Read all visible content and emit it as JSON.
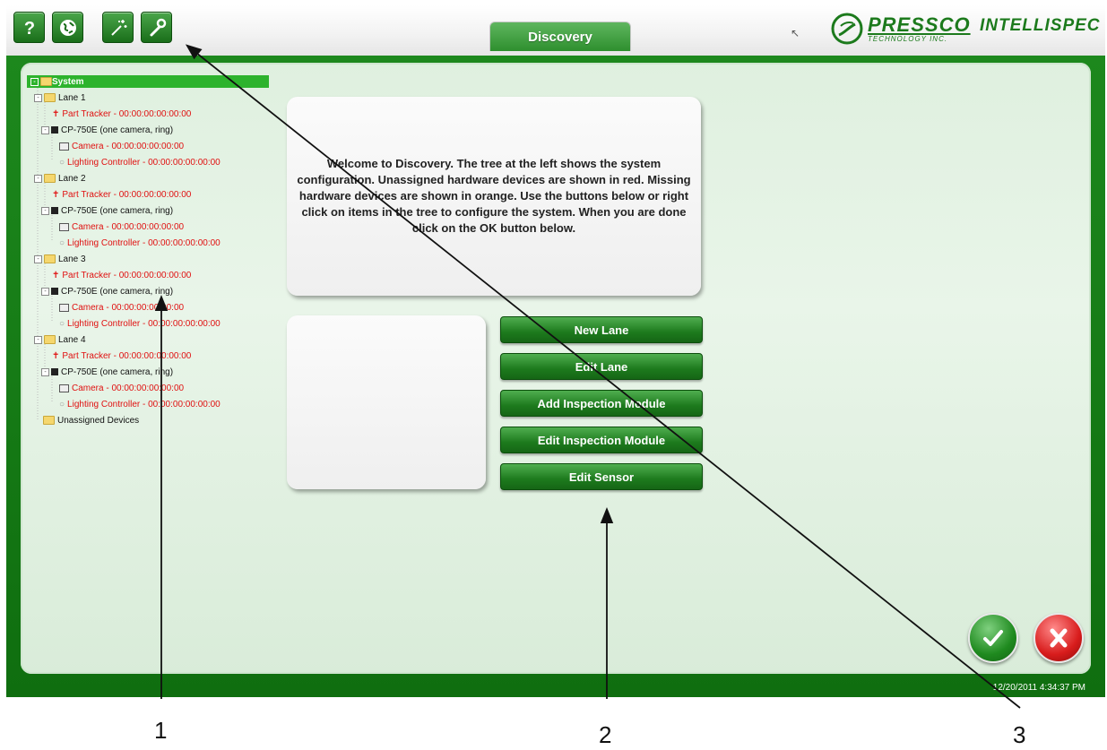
{
  "toolbar": {
    "buttons": [
      {
        "name": "help",
        "icon": "question-icon"
      },
      {
        "name": "globe",
        "icon": "globe-icon"
      },
      {
        "name": "wizard",
        "icon": "magic-wand-icon"
      },
      {
        "name": "tools",
        "icon": "wrench-icon"
      }
    ]
  },
  "tab": {
    "label": "Discovery"
  },
  "brand": {
    "pressco": "PRESSCO",
    "pressco_sub": "TECHNOLOGY INC.",
    "intellispec": "INTELLISPEC",
    "accent_color": "#1c7a1c"
  },
  "tree": {
    "root": "System",
    "lanes": [
      {
        "label": "Lane 1",
        "part_tracker": "Part Tracker - 00:00:00:00:00:00",
        "cp": "CP-750E (one camera, ring)",
        "camera": "Camera - 00:00:00:00:00:00",
        "lighting": "Lighting Controller - 00:00:00:00:00:00"
      },
      {
        "label": "Lane 2",
        "part_tracker": "Part Tracker - 00:00:00:00:00:00",
        "cp": "CP-750E (one camera, ring)",
        "camera": "Camera - 00:00:00:00:00:00",
        "lighting": "Lighting Controller - 00:00:00:00:00:00"
      },
      {
        "label": "Lane 3",
        "part_tracker": "Part Tracker - 00:00:00:00:00:00",
        "cp": "CP-750E (one camera, ring)",
        "camera": "Camera - 00:00:00:00:00:00",
        "lighting": "Lighting Controller - 00:00:00:00:00:00"
      },
      {
        "label": "Lane 4",
        "part_tracker": "Part Tracker - 00:00:00:00:00:00",
        "cp": "CP-750E (one camera, ring)",
        "camera": "Camera - 00:00:00:00:00:00",
        "lighting": "Lighting Controller - 00:00:00:00:00:00"
      }
    ],
    "unassigned": "Unassigned Devices"
  },
  "welcome": {
    "text": "Welcome to Discovery. The tree at the left shows the system configuration. Unassigned hardware devices are shown in red. Missing hardware devices are shown in orange. Use the buttons below or right click on items in the tree to configure the system. When you are done click on the OK button below."
  },
  "actions": {
    "new_lane": "New Lane",
    "edit_lane": "Edit Lane",
    "add_module": "Add Inspection Module",
    "edit_module": "Edit Inspection Module",
    "edit_sensor": "Edit Sensor"
  },
  "dialog": {
    "ok_icon": "checkmark-icon",
    "cancel_icon": "x-icon"
  },
  "status": {
    "datetime": "12/20/2011 4:34:37 PM"
  },
  "callouts": {
    "c1": "1",
    "c2": "2",
    "c3": "3"
  },
  "colors": {
    "unassigned": "#e01010",
    "frame": "#1e8a1e",
    "panel": "#e2f1e2"
  }
}
